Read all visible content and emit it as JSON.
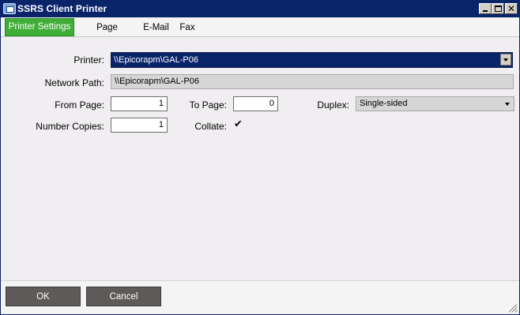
{
  "window": {
    "title": "SSRS Client Printer",
    "controls": [
      "minimize",
      "maximize",
      "close"
    ]
  },
  "tabs": [
    {
      "label": "Printer Settings",
      "active": true
    },
    {
      "label": "Page Setting",
      "active": false
    },
    {
      "label": "E-Mail",
      "active": false
    },
    {
      "label": "Fax",
      "active": false
    }
  ],
  "form": {
    "printer_label": "Printer:",
    "printer_value": "\\\\Epicorapm\\GAL-P06",
    "network_path_label": "Network Path:",
    "network_path_value": "\\\\Epicorapm\\GAL-P06",
    "from_page_label": "From Page:",
    "from_page_value": "1",
    "to_page_label": "To Page:",
    "to_page_value": "0",
    "duplex_label": "Duplex:",
    "duplex_value": "Single-sided",
    "copies_label": "Number Copies:",
    "copies_value": "1",
    "collate_label": "Collate:",
    "collate_checked": true
  },
  "footer": {
    "ok_label": "OK",
    "cancel_label": "Cancel"
  },
  "colors": {
    "titlebar": "#0a246a",
    "active_tab": "#3fae37",
    "selection": "#0a246a",
    "button": "#5e5a5a"
  }
}
